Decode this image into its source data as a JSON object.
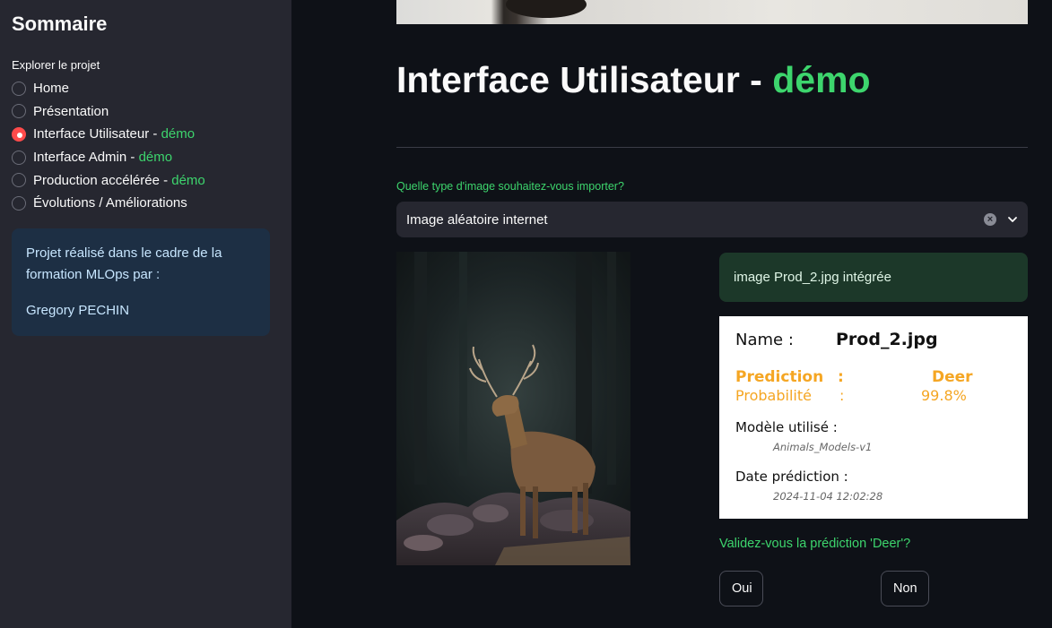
{
  "sidebar": {
    "title": "Sommaire",
    "nav_label": "Explorer le projet",
    "items": [
      {
        "label": "Home",
        "suffix": "",
        "checked": false
      },
      {
        "label": "Présentation",
        "suffix": "",
        "checked": false
      },
      {
        "label": "Interface Utilisateur - ",
        "suffix": "démo",
        "checked": true
      },
      {
        "label": "Interface Admin - ",
        "suffix": "démo",
        "checked": false
      },
      {
        "label": "Production accélérée - ",
        "suffix": "démo",
        "checked": false
      },
      {
        "label": "Évolutions / Améliorations",
        "suffix": "",
        "checked": false
      }
    ],
    "info": {
      "line1": "Projet réalisé dans le cadre de la formation MLOps par :",
      "author": "Gregory PECHIN"
    }
  },
  "main": {
    "title_prefix": "Interface Utilisateur - ",
    "title_highlight": "démo",
    "select": {
      "label": "Quelle type d'image souhaitez-vous importer?",
      "value": "Image aléatoire internet"
    },
    "success_message": "image Prod_2.jpg intégrée",
    "result": {
      "name_label": "Name :",
      "name_value": "Prod_2.jpg",
      "prediction_label": "Prediction",
      "prediction_colon": ":",
      "prediction_value": "Deer",
      "probability_label": "Probabilité",
      "probability_colon": ":",
      "probability_value": "99.8%",
      "model_label": "Modèle utilisé :",
      "model_value": "Animals_Models-v1",
      "date_label": "Date prédiction :",
      "date_value": "2024-11-04 12:02:28"
    },
    "validate_question": "Validez-vous la prédiction 'Deer'?",
    "buttons": {
      "yes": "Oui",
      "no": "Non"
    }
  },
  "colors": {
    "accent_green": "#3dd56d",
    "radio_selected": "#ff4b4b",
    "prediction_orange": "#f5a623"
  }
}
